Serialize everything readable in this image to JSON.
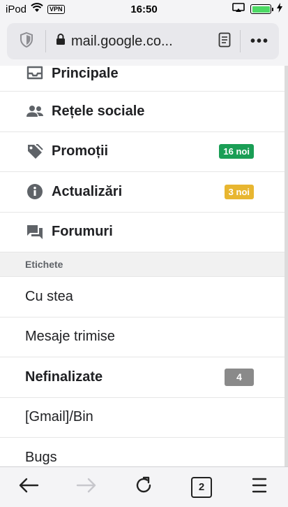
{
  "status_bar": {
    "device": "iPod",
    "vpn": "VPN",
    "time": "16:50"
  },
  "url_bar": {
    "url": "mail.google.co...",
    "menu": "•••"
  },
  "categories": [
    {
      "label": "Principale",
      "icon": "inbox-icon"
    },
    {
      "label": "Rețele sociale",
      "icon": "people-icon"
    },
    {
      "label": "Promoții",
      "icon": "tag-icon",
      "badge": "16 noi",
      "badge_color": "#1a9e55"
    },
    {
      "label": "Actualizări",
      "icon": "info-icon",
      "badge": "3 noi",
      "badge_color": "#e8b630"
    },
    {
      "label": "Forumuri",
      "icon": "forum-icon"
    }
  ],
  "labels_section": {
    "header": "Etichete",
    "items": [
      {
        "label": "Cu stea"
      },
      {
        "label": "Mesaje trimise"
      },
      {
        "label": "Nefinalizate",
        "count": "4"
      },
      {
        "label": "[Gmail]/Bin"
      },
      {
        "label": "Bugs"
      }
    ]
  },
  "toolbar": {
    "tabs_count": "2"
  }
}
